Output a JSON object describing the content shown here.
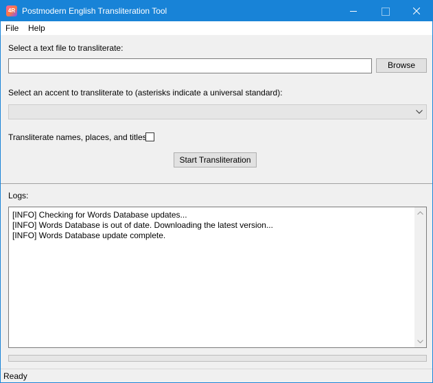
{
  "window": {
    "title": "Postmodern English Transliteration Tool",
    "icon_text": "4R",
    "accent_color": "#1883d7"
  },
  "menu": {
    "file": "File",
    "help": "Help"
  },
  "form": {
    "file_label": "Select a text file to transliterate:",
    "file_value": "",
    "browse_label": "Browse",
    "accent_label": "Select an accent to transliterate to (asterisks indicate a universal standard):",
    "accent_value": "",
    "names_label": "Transliterate names, places, and titles:",
    "names_checked": false,
    "start_label": "Start Transliteration"
  },
  "logs": {
    "label": "Logs:",
    "lines": [
      "[INFO] Checking for Words Database updates...",
      "[INFO] Words Database is out of date. Downloading the latest version...",
      "[INFO] Words Database update complete."
    ]
  },
  "progress": {
    "fraction": 0
  },
  "status": {
    "text": "Ready"
  }
}
